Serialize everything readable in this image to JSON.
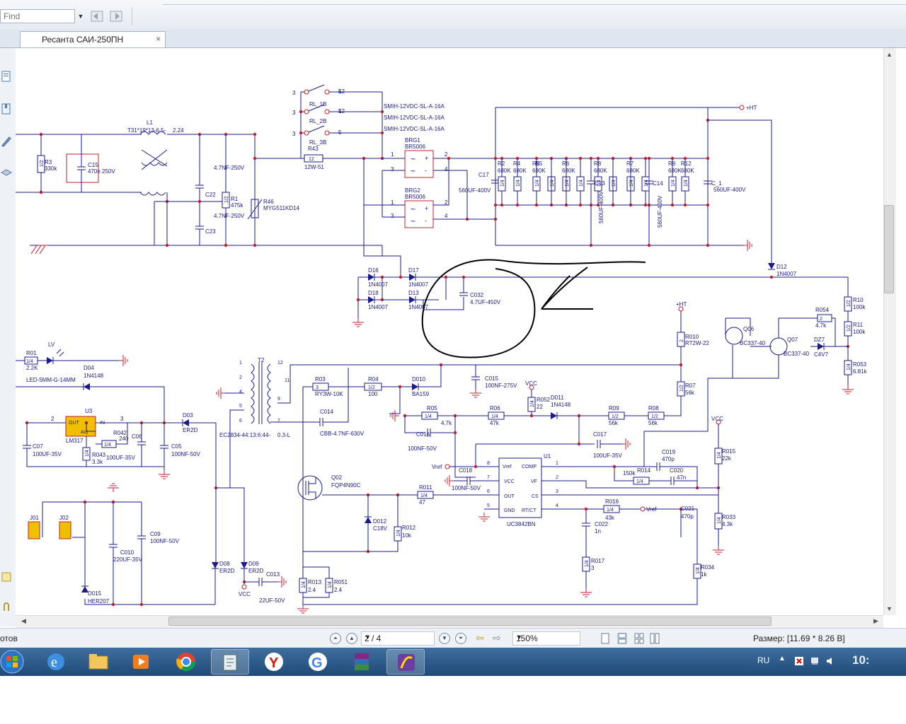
{
  "toolbar": {
    "find_placeholder": "Find"
  },
  "tabs": [
    {
      "title": "Ресанта САИ-250ПН",
      "close": "×"
    }
  ],
  "status": {
    "left_text": "отов",
    "page": "2 / 4",
    "zoom": "150%",
    "size_label": "Размер: [11.69 * 8.26 В]"
  },
  "taskbar": {
    "lang": "RU",
    "clock": "10:"
  },
  "schematic": {
    "labels": {
      "L1": "L1",
      "L1_spec": "T31*19*13-6.5-",
      "L1_v": "2.24",
      "R3": "R3",
      "R3_v": "330k",
      "C15": "C15",
      "C15_v": "470n 250V",
      "C22": "C22",
      "C22_v": "4.7NF-250V",
      "C23": "C23",
      "C23_v": "4.7NF-250V",
      "R1": "R1",
      "R1_v": "475k",
      "R46": "R46",
      "R46_v": "MYG511KD14",
      "R43": "R43",
      "R43_v": "12W-51",
      "RL1": "RL_1B",
      "RL2": "RL_2B",
      "RL3": "RL_3B",
      "relay_spec": "SMIH-12VDC-SL-A-16A",
      "BRG1": "BRG1",
      "BRG1_v": "BR5006",
      "BRG2": "BRG2",
      "BRG2_v": "BR5006",
      "C17": "C17",
      "C17_v": "560UF-400V",
      "R2": "R2",
      "R4": "R4",
      "R5": "R5",
      "R6": "R6",
      "R8": "R8",
      "R7": "R7",
      "R9": "R9",
      "R12": "R12",
      "r680": "680K",
      "C13": "C13",
      "C14": "C14",
      "C_1": "C_1",
      "C_1_v": "560UF-400V",
      "c560": "560UF-400V",
      "HT": "+HT",
      "D16": "D16",
      "D17": "D17",
      "D18": "D18",
      "D13": "D13",
      "d4007": "1N4007",
      "C032": "C032",
      "C032_v": "4.7UF-450V",
      "D12": "D12",
      "R10": "R10",
      "R10_v": "100k",
      "R11": "R11",
      "R11_v": "100k",
      "R053": "R053",
      "R053_v": "6.81k",
      "R054": "R054",
      "R054_v": "4.7k",
      "Q06": "Q06",
      "Q07": "Q07",
      "bc": "BC337-40",
      "DZ7": "DZ7",
      "DZ7_v": "C4V7",
      "R010": "R010",
      "R010_v": "RT2W-22",
      "R07": "R07",
      "R07_v": "56k",
      "R01": "R01",
      "R01_v": "2.2K",
      "LV": "LV",
      "LED": "LED-5MM-G-14MM",
      "D04": "D04",
      "D04_v": "1N4148",
      "T2": "T2",
      "T2_v": "EC2834-44:13:6:44-",
      "T2_l": "0.3-L",
      "R03": "R03",
      "R03_v": "RY3W-10K",
      "R04": "R04",
      "R04_v": "100",
      "D010": "D010",
      "D010_v": "BA159",
      "C015": "C015",
      "C015_v": "100NF-275V",
      "VCC": "VCC",
      "R052": "R052",
      "R052_v": "22",
      "D011": "D011",
      "D011_v": "1N4148",
      "U3": "U3",
      "U3_v": "LM317",
      "OUT": "OUT",
      "IN": "IN",
      "Adj": "Adj",
      "D03": "D03",
      "D03_v": "ER2D",
      "C07": "C07",
      "C07_v": "100UF-35V",
      "R042": "R042",
      "R042_v": "240",
      "C06": "C06",
      "C06_v": "100UF-35V",
      "R043": "R043",
      "R043_v": "3.3k",
      "C05": "C05",
      "C05_v": "100NF-50V",
      "C014": "C014",
      "C014_v": "CBB-4.7NF-630V",
      "R05": "R05",
      "R05_v": "4.7k",
      "R06": "R06",
      "R06_v": "47k",
      "R09": "R09",
      "R09_v": "56k",
      "R08": "R08",
      "R08_v": "56k",
      "C016": "C016",
      "C016_v": "100NF-50V",
      "C017": "C017",
      "C017_v": "100UF-35V",
      "U1": "U1",
      "U1_v": "UC3842BN",
      "Vref": "Vref",
      "COMP": "COMP",
      "VCCpin": "VCC",
      "VF": "VF",
      "OUTpin": "OUT",
      "CS": "CS",
      "GND": "GND",
      "RTCT": "RT/CT",
      "C018": "C018",
      "C018_v": "100NF-50V",
      "C019": "C019",
      "C019_v": "470p",
      "R014": "R014",
      "R014_v": "150k",
      "C020": "C020",
      "C020_v": "47n",
      "R015": "R015",
      "R015_v": "22k",
      "R033": "R033",
      "R033_v": "4.3k",
      "Q02": "Q02",
      "Q02_v": "FQP4N90C",
      "R011": "R011",
      "R011_v": "47",
      "D012": "D012",
      "D012_v": "C18V",
      "R012": "R012",
      "R012_v": "10k",
      "R016": "R016",
      "R016_v": "43k",
      "C021": "C021",
      "C021_v": "470p",
      "C022": "C022",
      "C022_v": "1n",
      "R017": "R017",
      "R017_v": "3",
      "R034": "R034",
      "R034_v": "1k",
      "R013": "R013",
      "R013_v": "2.4",
      "R051": "R051",
      "R051_v": "2.4",
      "J01": "J01",
      "J02": "J02",
      "C010": "C010",
      "C010_v": "220UF-35V",
      "C09": "C09",
      "C09_v": "100NF-50V",
      "D015": "D015",
      "D015_v": "HER207",
      "D08": "D08",
      "D09": "D09",
      "er2d": "ER2D",
      "C013": "C013",
      "C013_v": "22UF-50V",
      "r14": "1/4",
      "r12": "1/2",
      "r1_2": "1/2",
      "r2": "2",
      "r3": "3",
      "p12": "12",
      "pins": [
        "1",
        "2",
        "3",
        "4",
        "5",
        "6",
        "7",
        "8"
      ]
    }
  }
}
